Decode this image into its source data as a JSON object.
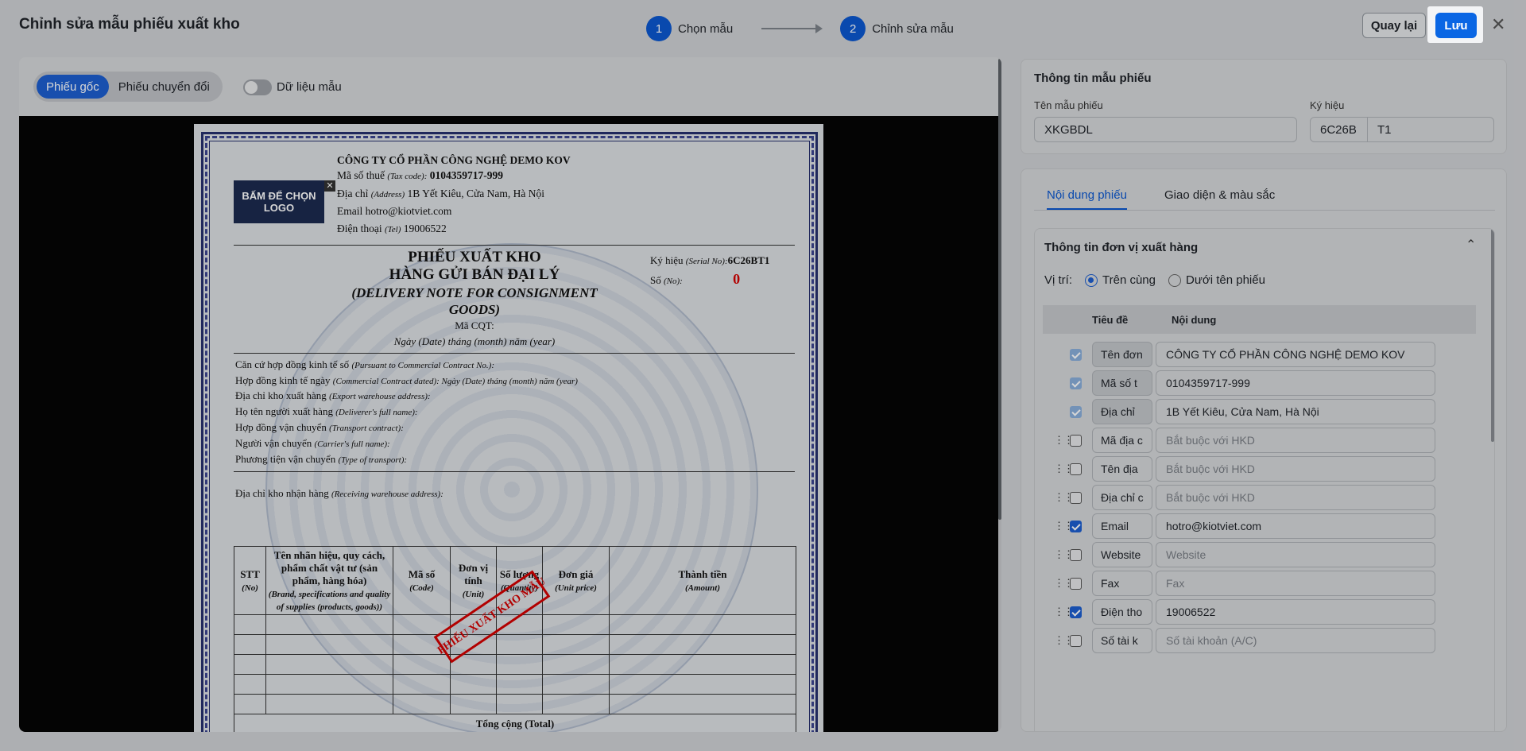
{
  "header": {
    "title": "Chỉnh sửa mẫu phiếu xuất kho",
    "steps": [
      {
        "num": "1",
        "label": "Chọn mẫu"
      },
      {
        "num": "2",
        "label": "Chỉnh sửa mẫu"
      }
    ],
    "back_label": "Quay lại",
    "save_label": "Lưu",
    "close_label": "✕"
  },
  "left": {
    "tabs": [
      {
        "label": "Phiếu gốc"
      },
      {
        "label": "Phiếu chuyển đổi"
      }
    ],
    "sample_toggle_label": "Dữ liệu mẫu"
  },
  "doc": {
    "logo_text": "BẤM ĐỂ CHỌN LOGO",
    "logo_close": "✕",
    "company": "CÔNG TY CỔ PHẦN CÔNG NGHỆ DEMO KOV",
    "tax_label": "Mã số thuế",
    "tax_en": "(Tax code):",
    "tax": "0104359717-999",
    "addr_label": "Địa chỉ",
    "addr_en": "(Address)",
    "addr": "1B Yết Kiêu, Cửa Nam, Hà Nội",
    "email_line": "Email hotro@kiotviet.com",
    "phone_label": "Điện thoại",
    "phone_en": "(Tel)",
    "phone": "19006522",
    "title1": "PHIẾU XUẤT KHO",
    "title2": "HÀNG GỬI BÁN ĐẠI LÝ",
    "title_en1": "(DELIVERY NOTE FOR CONSIGNMENT",
    "title_en2": "GOODS)",
    "cqt": "Mã CQT:",
    "date_line": "Ngày (Date) tháng (month) năm (year)",
    "serial_label": "Ký hiệu",
    "serial_en": "(Serial No):",
    "serial": "6C26BT1",
    "no_label": "Số",
    "no_en": "(No):",
    "no": "0",
    "fields": [
      {
        "vi": "Căn cứ hợp đồng kinh tế số",
        "en": "(Pursuant to Commercial Contract No.):"
      },
      {
        "vi": "Hợp đồng kinh tế ngày",
        "en": "(Commercial Contract dated): Ngày (Date) tháng (month) năm (year)"
      },
      {
        "vi": "Địa chỉ kho xuất hàng",
        "en": "(Export warehouse address):"
      },
      {
        "vi": "Họ tên người xuất hàng",
        "en": "(Deliverer's full name):"
      },
      {
        "vi": "Hợp đồng vận chuyển",
        "en": "(Transport contract):"
      },
      {
        "vi": "Người vận chuyển",
        "en": "(Carrier's full name):"
      },
      {
        "vi": "Phương tiện vận chuyển",
        "en": "(Type of transport):"
      }
    ],
    "recv": {
      "vi": "Địa chỉ kho nhận hàng",
      "en": "(Receiving warehouse address):"
    },
    "cols": [
      {
        "vi": "STT",
        "en": "(No)"
      },
      {
        "vi": "Tên nhãn hiệu, quy cách, phẩm chất vật tư (sản phẩm, hàng hóa)",
        "en": "(Brand, specifications and quality of supplies (products, goods))"
      },
      {
        "vi": "Mã số",
        "en": "(Code)"
      },
      {
        "vi": "Đơn vị tính",
        "en": "(Unit)"
      },
      {
        "vi": "Số lượng",
        "en": "(Quantity)"
      },
      {
        "vi": "Đơn giá",
        "en": "(Unit price)"
      },
      {
        "vi": "Thành tiền",
        "en": "(Amount)"
      }
    ],
    "total": "Tổng cộng (Total)",
    "stamp": "PHIẾU XUẤT KHO MẪU"
  },
  "info": {
    "title": "Thông tin mẫu phiếu",
    "name_label": "Tên mẫu phiếu",
    "name": "XKGBDL",
    "code_label": "Ký hiệu",
    "code_prefix": "6C26B",
    "code": "T1"
  },
  "content": {
    "tabs": [
      {
        "label": "Nội dung phiếu"
      },
      {
        "label": "Giao diện & màu sắc"
      }
    ],
    "section_title": "Thông tin đơn vị xuất hàng",
    "pos_label": "Vị trí:",
    "pos_options": [
      "Trên cùng",
      "Dưới tên phiếu"
    ],
    "col_title": "Tiêu đề",
    "col_content": "Nội dung",
    "rows": [
      {
        "title": "Tên đơn",
        "value": "CÔNG TY CỔ PHẦN CÔNG NGHỆ DEMO KOV",
        "state": "dis",
        "ph": false,
        "drag": false
      },
      {
        "title": "Mã số t",
        "value": "0104359717-999",
        "state": "dis",
        "ph": false,
        "drag": false
      },
      {
        "title": "Địa chỉ",
        "value": "1B Yết Kiêu, Cửa Nam, Hà Nội",
        "state": "dis",
        "ph": false,
        "drag": false
      },
      {
        "title": "Mã địa c",
        "value": "Bắt buộc với HKD",
        "state": "off",
        "ph": true,
        "drag": true
      },
      {
        "title": "Tên địa",
        "value": "Bắt buộc với HKD",
        "state": "off",
        "ph": true,
        "drag": true
      },
      {
        "title": "Địa chỉ c",
        "value": "Bắt buộc với HKD",
        "state": "off",
        "ph": true,
        "drag": true
      },
      {
        "title": "Email",
        "value": "hotro@kiotviet.com",
        "state": "on",
        "ph": false,
        "drag": true
      },
      {
        "title": "Website",
        "value": "Website",
        "state": "off",
        "ph": true,
        "drag": true
      },
      {
        "title": "Fax",
        "value": "Fax",
        "state": "off",
        "ph": true,
        "drag": true
      },
      {
        "title": "Điện tho",
        "value": "19006522",
        "state": "on",
        "ph": false,
        "drag": true
      },
      {
        "title": "Số tài k",
        "value": "Số tài khoản (A/C)",
        "state": "off",
        "ph": true,
        "drag": true
      }
    ]
  }
}
